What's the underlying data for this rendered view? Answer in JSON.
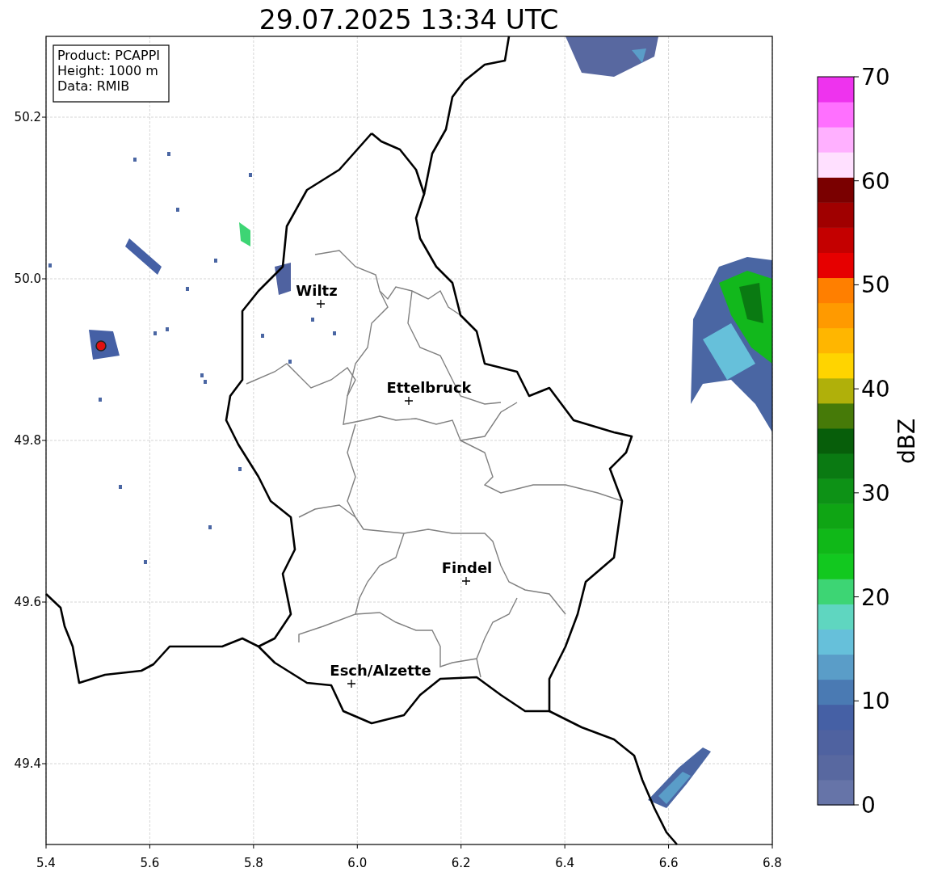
{
  "title": "29.07.2025 13:34 UTC",
  "info_box": [
    "Product: PCAPPI",
    "Height: 1000 m",
    "Data: RMIB"
  ],
  "x_ticks": [
    "5.4",
    "5.6",
    "5.8",
    "6.0",
    "6.2",
    "6.4",
    "6.6",
    "6.8"
  ],
  "y_ticks": [
    "50.2",
    "50.0",
    "49.8",
    "49.6",
    "49.4"
  ],
  "cities": [
    {
      "name": "Wiltz"
    },
    {
      "name": "Ettelbruck"
    },
    {
      "name": "Findel"
    },
    {
      "name": "Esch/Alzette"
    }
  ],
  "colorbar": {
    "label": "dBZ",
    "ticks": [
      "70",
      "60",
      "50",
      "40",
      "30",
      "20",
      "10",
      "0"
    ],
    "segments": [
      {
        "color": "#6674a8"
      },
      {
        "color": "#5868a0"
      },
      {
        "color": "#4f62a0"
      },
      {
        "color": "#4560a5"
      },
      {
        "color": "#4a7ab3"
      },
      {
        "color": "#5a9dc8"
      },
      {
        "color": "#66c0da"
      },
      {
        "color": "#5fd6c0"
      },
      {
        "color": "#3dd574"
      },
      {
        "color": "#12c81f"
      },
      {
        "color": "#10b818"
      },
      {
        "color": "#0fa514"
      },
      {
        "color": "#0d9216"
      },
      {
        "color": "#0a7a12"
      },
      {
        "color": "#075e0a"
      },
      {
        "color": "#467a08"
      },
      {
        "color": "#b0b00a"
      },
      {
        "color": "#ffd400"
      },
      {
        "color": "#ffb600"
      },
      {
        "color": "#ff9a00"
      },
      {
        "color": "#ff7f00"
      },
      {
        "color": "#e60000"
      },
      {
        "color": "#c40000"
      },
      {
        "color": "#a00000"
      },
      {
        "color": "#7a0000"
      },
      {
        "color": "#ffe0ff"
      },
      {
        "color": "#ffb0ff"
      },
      {
        "color": "#ff70ff"
      },
      {
        "color": "#ee33ee"
      }
    ]
  }
}
